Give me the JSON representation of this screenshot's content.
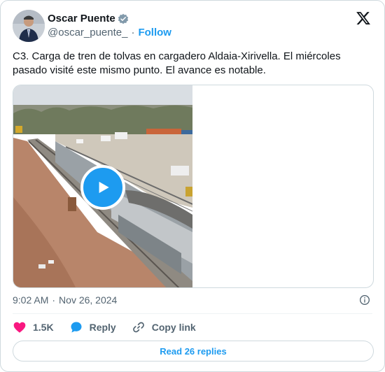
{
  "author": {
    "display_name": "Oscar Puente",
    "handle": "@oscar_puente_",
    "separator": "·",
    "follow_label": "Follow"
  },
  "tweet": {
    "text": "C3. Carga de tren de tolvas en cargadero Aldaia-Xirivella. El miércoles pasado visité este mismo punto. El avance es notable."
  },
  "meta": {
    "time": "9:02 AM",
    "separator": "·",
    "date": "Nov 26, 2024"
  },
  "actions": {
    "like_count": "1.5K",
    "reply_label": "Reply",
    "copy_link_label": "Copy link"
  },
  "replies_button": "Read 26 replies",
  "colors": {
    "accent": "#1d9bf0",
    "like": "#f91880",
    "muted": "#536471",
    "border": "#cfd9de"
  },
  "icons": [
    "verified-badge-icon",
    "x-logo-icon",
    "play-icon",
    "info-icon",
    "heart-icon",
    "reply-bubble-icon",
    "link-icon"
  ]
}
